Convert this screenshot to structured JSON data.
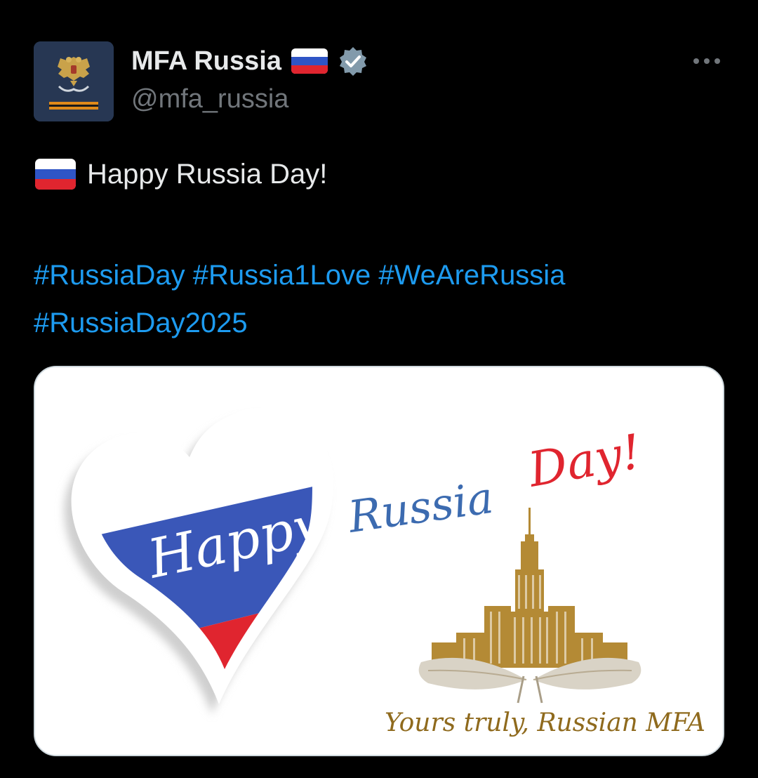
{
  "author": {
    "display_name": "MFA Russia",
    "handle": "@mfa_russia",
    "avatar_icon": "coat-of-arms-icon",
    "verified_icon": "verified-badge-icon",
    "name_flag_icon": "russian-flag-icon"
  },
  "menu": {
    "icon": "more-options-icon"
  },
  "tweet": {
    "flag_icon": "russian-flag-icon",
    "text": "Happy Russia Day!",
    "hashtags": [
      "#RussiaDay",
      "#Russia1Love",
      "#WeAreRussia",
      "#RussiaDay2025"
    ]
  },
  "media": {
    "happy_text": "Happy",
    "russia_text": "Russia",
    "day_text": "Day!",
    "signature_text": "Yours truly, Russian MFA",
    "building_icon": "mfa-building-icon",
    "heart_icon": "flag-heart-icon"
  },
  "colors": {
    "background": "#000000",
    "link_blue": "#1d9bf0",
    "flag_white": "#ffffff",
    "flag_blue": "#3a57b8",
    "flag_red": "#e0252f",
    "gold": "#b48a35",
    "verified_gray": "#829aab"
  }
}
